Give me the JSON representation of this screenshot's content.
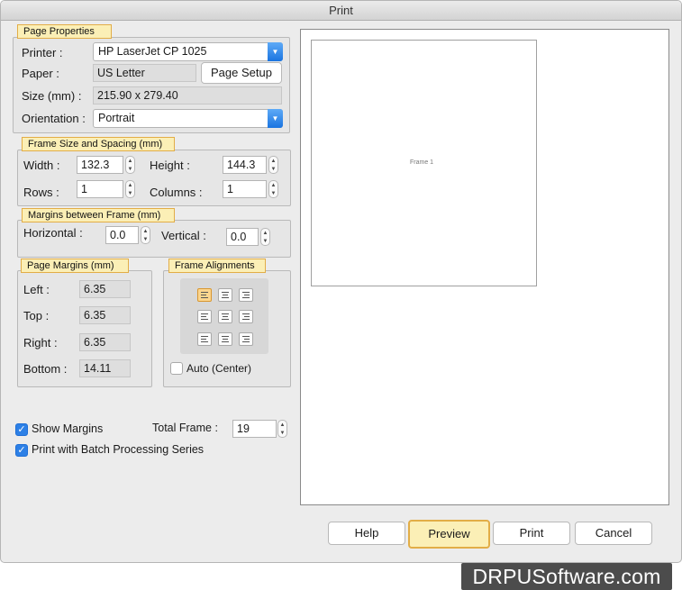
{
  "window": {
    "title": "Print"
  },
  "page_properties": {
    "legend": "Page Properties",
    "printer_label": "Printer :",
    "printer_value": "HP LaserJet CP 1025",
    "paper_label": "Paper :",
    "paper_value": "US Letter",
    "page_setup_label": "Page Setup",
    "size_label": "Size (mm) :",
    "size_value": "215.90 x 279.40",
    "orientation_label": "Orientation :",
    "orientation_value": "Portrait"
  },
  "frame_size": {
    "legend": "Frame Size and Spacing (mm)",
    "width_label": "Width :",
    "width_value": "132.3",
    "height_label": "Height :",
    "height_value": "144.3",
    "rows_label": "Rows :",
    "rows_value": "1",
    "columns_label": "Columns :",
    "columns_value": "1"
  },
  "margins_between": {
    "legend": "Margins between Frame (mm)",
    "horizontal_label": "Horizontal :",
    "horizontal_value": "0.0",
    "vertical_label": "Vertical :",
    "vertical_value": "0.0"
  },
  "page_margins": {
    "legend": "Page Margins (mm)",
    "left_label": "Left :",
    "left_value": "6.35",
    "top_label": "Top :",
    "top_value": "6.35",
    "right_label": "Right :",
    "right_value": "6.35",
    "bottom_label": "Bottom :",
    "bottom_value": "14.11"
  },
  "frame_alignments": {
    "legend": "Frame Alignments",
    "selected": "top-left",
    "auto_center_label": "Auto (Center)",
    "auto_center_checked": false
  },
  "options": {
    "show_margins_label": "Show Margins",
    "show_margins_checked": true,
    "total_frame_label": "Total Frame :",
    "total_frame_value": "19",
    "batch_label": "Print with Batch Processing Series",
    "batch_checked": true
  },
  "preview": {
    "frame_label": "Frame 1"
  },
  "buttons": {
    "help": "Help",
    "preview": "Preview",
    "print": "Print",
    "cancel": "Cancel"
  },
  "watermark": "DRPUSoftware.com",
  "icons": {
    "dropdown": "chevron-down-icon",
    "stepper": "stepper-icon",
    "check": "checkmark-icon"
  },
  "colors": {
    "accent": "#2d80e6",
    "highlight": "#fbefb6",
    "highlight_border": "#e2ad47"
  }
}
